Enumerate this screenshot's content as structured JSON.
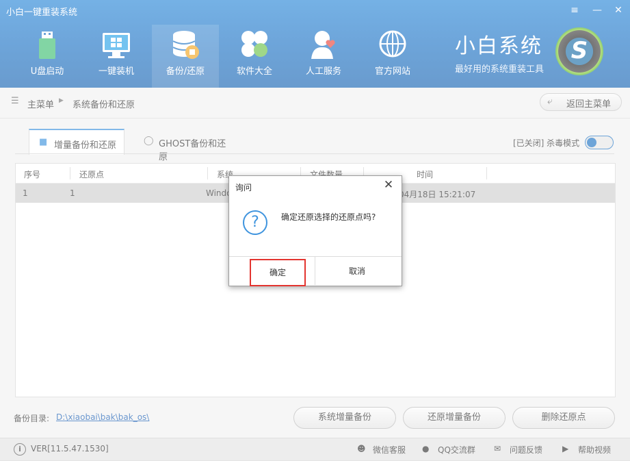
{
  "window": {
    "title": "小白一键重装系统"
  },
  "nav": [
    {
      "label": "U盘启动",
      "icon": "usb-drive-icon"
    },
    {
      "label": "一键装机",
      "icon": "monitor-windows-icon"
    },
    {
      "label": "备份/还原",
      "icon": "database-backup-icon",
      "active": true
    },
    {
      "label": "软件大全",
      "icon": "apps-clover-icon"
    },
    {
      "label": "人工服务",
      "icon": "person-heart-icon"
    },
    {
      "label": "官方网站",
      "icon": "globe-icon"
    }
  ],
  "brand": {
    "name": "小白系统",
    "slogan": "最好用的系统重装工具"
  },
  "breadcrumb": {
    "home": "主菜单",
    "current": "系统备份和还原"
  },
  "back_button": "返回主菜单",
  "tabs": [
    {
      "label": "增量备份和还原",
      "icon": "windows-flag-icon"
    },
    {
      "label": "GHOST备份和还原",
      "icon": "ghost-icon"
    }
  ],
  "antivirus": {
    "label": "[已关闭] 杀毒模式"
  },
  "table": {
    "headers": [
      "序号",
      "还原点",
      "系统",
      "文件数量",
      "时间"
    ],
    "rows": [
      {
        "index": "1",
        "point": "1",
        "system": "Windo",
        "time": "04月18日 15:21:07"
      }
    ]
  },
  "backup_dir": {
    "label": "备份目录:",
    "path": "D:\\xiaobai\\bak\\bak_os\\"
  },
  "actions": {
    "incremental": "系统增量备份",
    "restore": "还原增量备份",
    "delete": "删除还原点"
  },
  "status": {
    "version": "VER[11.5.47.1530]",
    "wechat": "微信客服",
    "qq": "QQ交流群",
    "feedback": "问题反馈",
    "help": "帮助视频"
  },
  "dialog": {
    "title": "询问",
    "message": "确定还原选择的还原点吗?",
    "ok": "确定",
    "cancel": "取消"
  },
  "colors": {
    "titlebar": "#1f73c4",
    "accent": "#3f94de",
    "highlight_border": "#e3342f"
  }
}
